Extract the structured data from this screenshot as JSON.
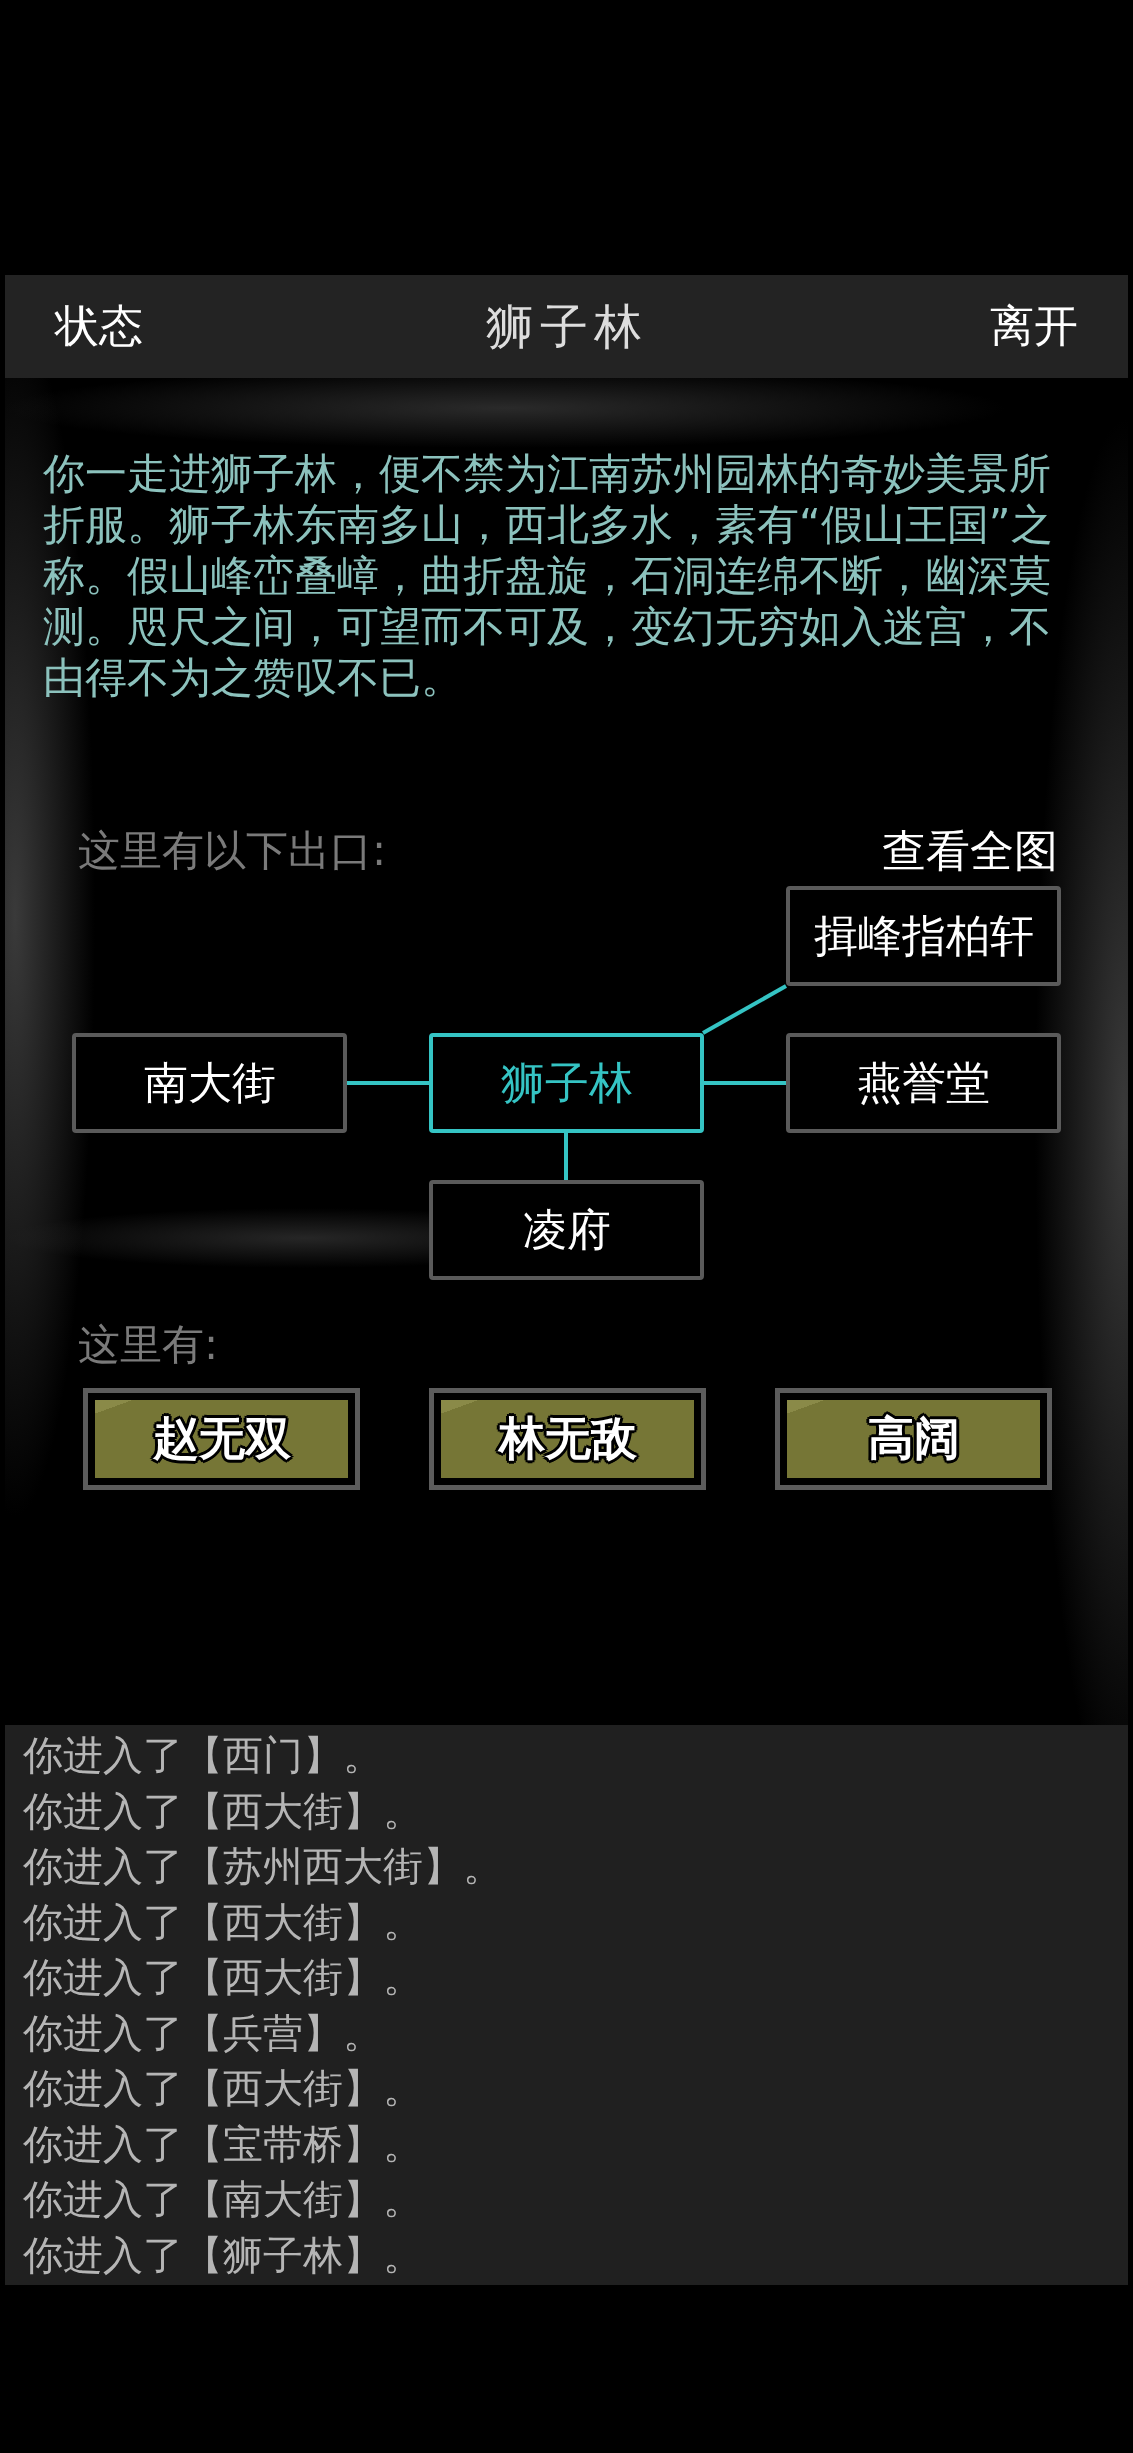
{
  "header": {
    "left_button": "状态",
    "title": "狮子林",
    "right_button": "离开"
  },
  "description": "你一走进狮子林，便不禁为江南苏州园林的奇妙美景所折服。狮子林东南多山，西北多水，素有“假山王国”之称。假山峰峦叠嶂，曲折盘旋，石洞连绵不断，幽深莫测。咫尺之间，可望而不可及，变幻无穷如入迷宫，不由得不为之赞叹不已。",
  "exits": {
    "label": "这里有以下出口:",
    "view_map_button": "查看全图",
    "nodes": [
      {
        "label": "揖峰指柏轩",
        "selected": false
      },
      {
        "label": "南大街",
        "selected": false
      },
      {
        "label": "狮子林",
        "selected": true
      },
      {
        "label": "燕誉堂",
        "selected": false
      },
      {
        "label": "凌府",
        "selected": false
      }
    ]
  },
  "people": {
    "label": "这里有:",
    "npcs": [
      "赵无双",
      "林无敌",
      "高阔"
    ]
  },
  "log": [
    "你进入了【西门】。",
    "你进入了【西大街】。",
    "你进入了【苏州西大街】。",
    "你进入了【西大街】。",
    "你进入了【西大街】。",
    "你进入了【兵营】。",
    "你进入了【西大街】。",
    "你进入了【宝带桥】。",
    "你进入了【南大街】。",
    "你进入了【狮子林】。"
  ]
}
